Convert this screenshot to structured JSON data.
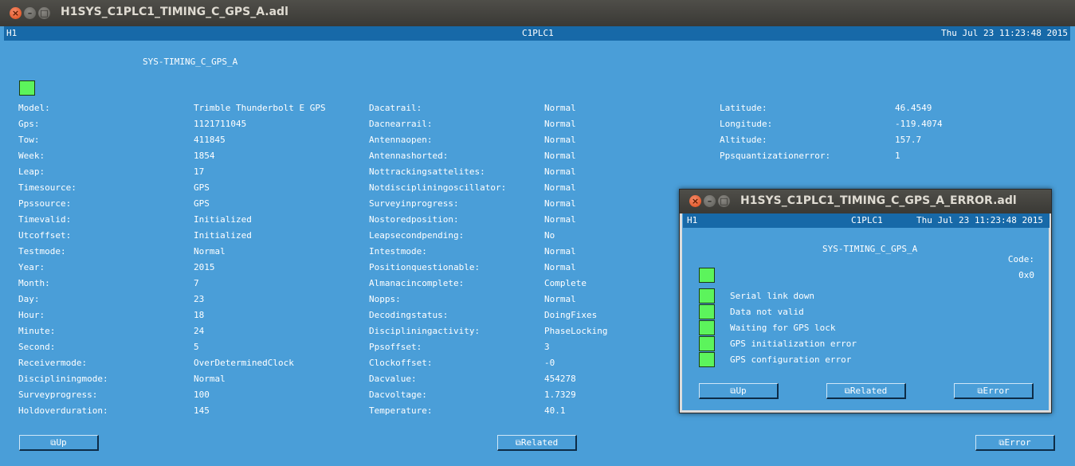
{
  "main": {
    "title": "H1SYS_C1PLC1_TIMING_C_GPS_A.adl",
    "header": {
      "left": "H1",
      "center": "C1PLC1",
      "right": "Thu Jul 23 11:23:48 2015"
    },
    "screen_title": "SYS-TIMING_C_GPS_A",
    "col1": [
      {
        "label": "Model:",
        "value": "Trimble Thunderbolt E GPS"
      },
      {
        "label": "Gps:",
        "value": "1121711045"
      },
      {
        "label": "Tow:",
        "value": "411845"
      },
      {
        "label": "Week:",
        "value": "1854"
      },
      {
        "label": "Leap:",
        "value": "17"
      },
      {
        "label": "Timesource:",
        "value": "GPS"
      },
      {
        "label": "Ppssource:",
        "value": "GPS"
      },
      {
        "label": "Timevalid:",
        "value": "Initialized"
      },
      {
        "label": "Utcoffset:",
        "value": "Initialized"
      },
      {
        "label": "Testmode:",
        "value": "Normal"
      },
      {
        "label": "Year:",
        "value": "2015"
      },
      {
        "label": "Month:",
        "value": "7"
      },
      {
        "label": "Day:",
        "value": "23"
      },
      {
        "label": "Hour:",
        "value": "18"
      },
      {
        "label": "Minute:",
        "value": "24"
      },
      {
        "label": "Second:",
        "value": "5"
      },
      {
        "label": "Receivermode:",
        "value": "OverDeterminedClock"
      },
      {
        "label": "Discipliningmode:",
        "value": "Normal"
      },
      {
        "label": "Surveyprogress:",
        "value": "100"
      },
      {
        "label": "Holdoverduration:",
        "value": "145"
      }
    ],
    "col2": [
      {
        "label": "Dacatrail:",
        "value": "Normal"
      },
      {
        "label": "Dacnearrail:",
        "value": "Normal"
      },
      {
        "label": "Antennaopen:",
        "value": "Normal"
      },
      {
        "label": "Antennashorted:",
        "value": "Normal"
      },
      {
        "label": "Nottrackingsattelites:",
        "value": "Normal"
      },
      {
        "label": "Notdiscipliningoscillator:",
        "value": "Normal"
      },
      {
        "label": "Surveyinprogress:",
        "value": "Normal"
      },
      {
        "label": "Nostoredposition:",
        "value": "Normal"
      },
      {
        "label": "Leapsecondpending:",
        "value": "No"
      },
      {
        "label": "Intestmode:",
        "value": "Normal"
      },
      {
        "label": "Positionquestionable:",
        "value": "Normal"
      },
      {
        "label": "Almanacincomplete:",
        "value": "Complete"
      },
      {
        "label": "Nopps:",
        "value": "Normal"
      },
      {
        "label": "Decodingstatus:",
        "value": "DoingFixes"
      },
      {
        "label": "Discipliningactivity:",
        "value": "PhaseLocking"
      },
      {
        "label": "Ppsoffset:",
        "value": "3"
      },
      {
        "label": "Clockoffset:",
        "value": "-0"
      },
      {
        "label": "Dacvalue:",
        "value": "454278"
      },
      {
        "label": "Dacvoltage:",
        "value": "1.7329"
      },
      {
        "label": "Temperature:",
        "value": "40.1"
      }
    ],
    "col3": [
      {
        "label": "Latitude:",
        "value": "46.4549"
      },
      {
        "label": "Longitude:",
        "value": "-119.4074"
      },
      {
        "label": "Altitude:",
        "value": "157.7"
      },
      {
        "label": "Ppsquantizationerror:",
        "value": "1"
      }
    ],
    "buttons": {
      "up": "Up",
      "related": "Related",
      "error": "Error"
    }
  },
  "error_window": {
    "title": "H1SYS_C1PLC1_TIMING_C_GPS_A_ERROR.adl",
    "header": {
      "left": "H1",
      "center": "C1PLC1",
      "right": "Thu Jul 23 11:23:48 2015"
    },
    "screen_title": "SYS-TIMING_C_GPS_A",
    "code_label": "Code:",
    "code_value": "0x0",
    "errors": [
      "Serial link down",
      "Data not valid",
      "Waiting for GPS lock",
      "GPS initialization error",
      "GPS configuration error"
    ],
    "buttons": {
      "up": "Up",
      "related": "Related",
      "error": "Error"
    }
  },
  "colors": {
    "background": "#4a9ed8",
    "header": "#1769a8",
    "led_ok": "#5cf45c"
  },
  "icons": {
    "window_close": "×",
    "window_minimize": "–",
    "window_maximize": "□",
    "related_display": "⧉"
  }
}
